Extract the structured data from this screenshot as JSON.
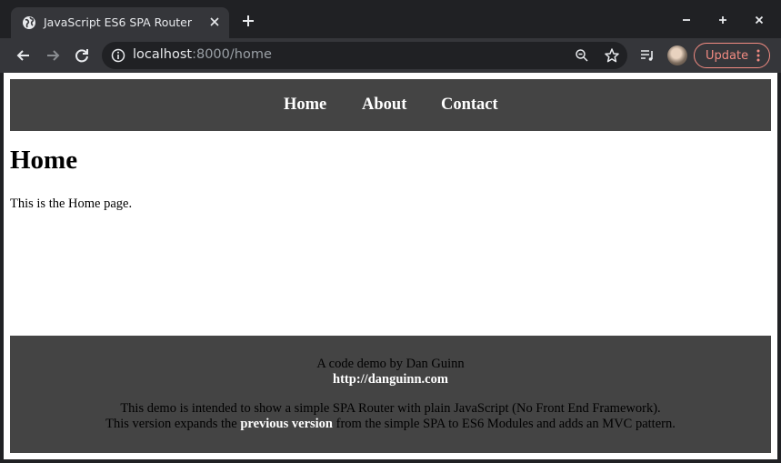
{
  "browser": {
    "tab_title": "JavaScript ES6 SPA Router",
    "url_host": "localhost",
    "url_path": ":8000/home",
    "update_label": "Update"
  },
  "site": {
    "nav": [
      "Home",
      "About",
      "Contact"
    ],
    "page_title": "Home",
    "page_text": "This is the Home page.",
    "footer": {
      "credit": "A code demo by Dan Guinn",
      "site_link": "http://danguinn.com",
      "desc": "This demo is intended to show a simple SPA Router with plain JavaScript (No Front End Framework).",
      "desc2_pre": "This version expands the ",
      "desc2_link": "previous version",
      "desc2_post": " from the simple SPA to ES6 Modules and adds an MVC pattern."
    }
  },
  "colors": {
    "nav_bg": "#444444",
    "footer_bg": "#444444",
    "chrome_dark": "#202124",
    "chrome_toolbar": "#35363a",
    "update_accent": "#f28b82"
  },
  "icons": [
    "globe-icon",
    "close-icon",
    "plus-icon",
    "minimize-icon",
    "maximize-icon",
    "window-close-icon",
    "back-arrow-icon",
    "forward-arrow-icon",
    "reload-icon",
    "info-icon",
    "zoom-out-icon",
    "star-icon",
    "reading-list-icon",
    "more-vert-icon"
  ]
}
